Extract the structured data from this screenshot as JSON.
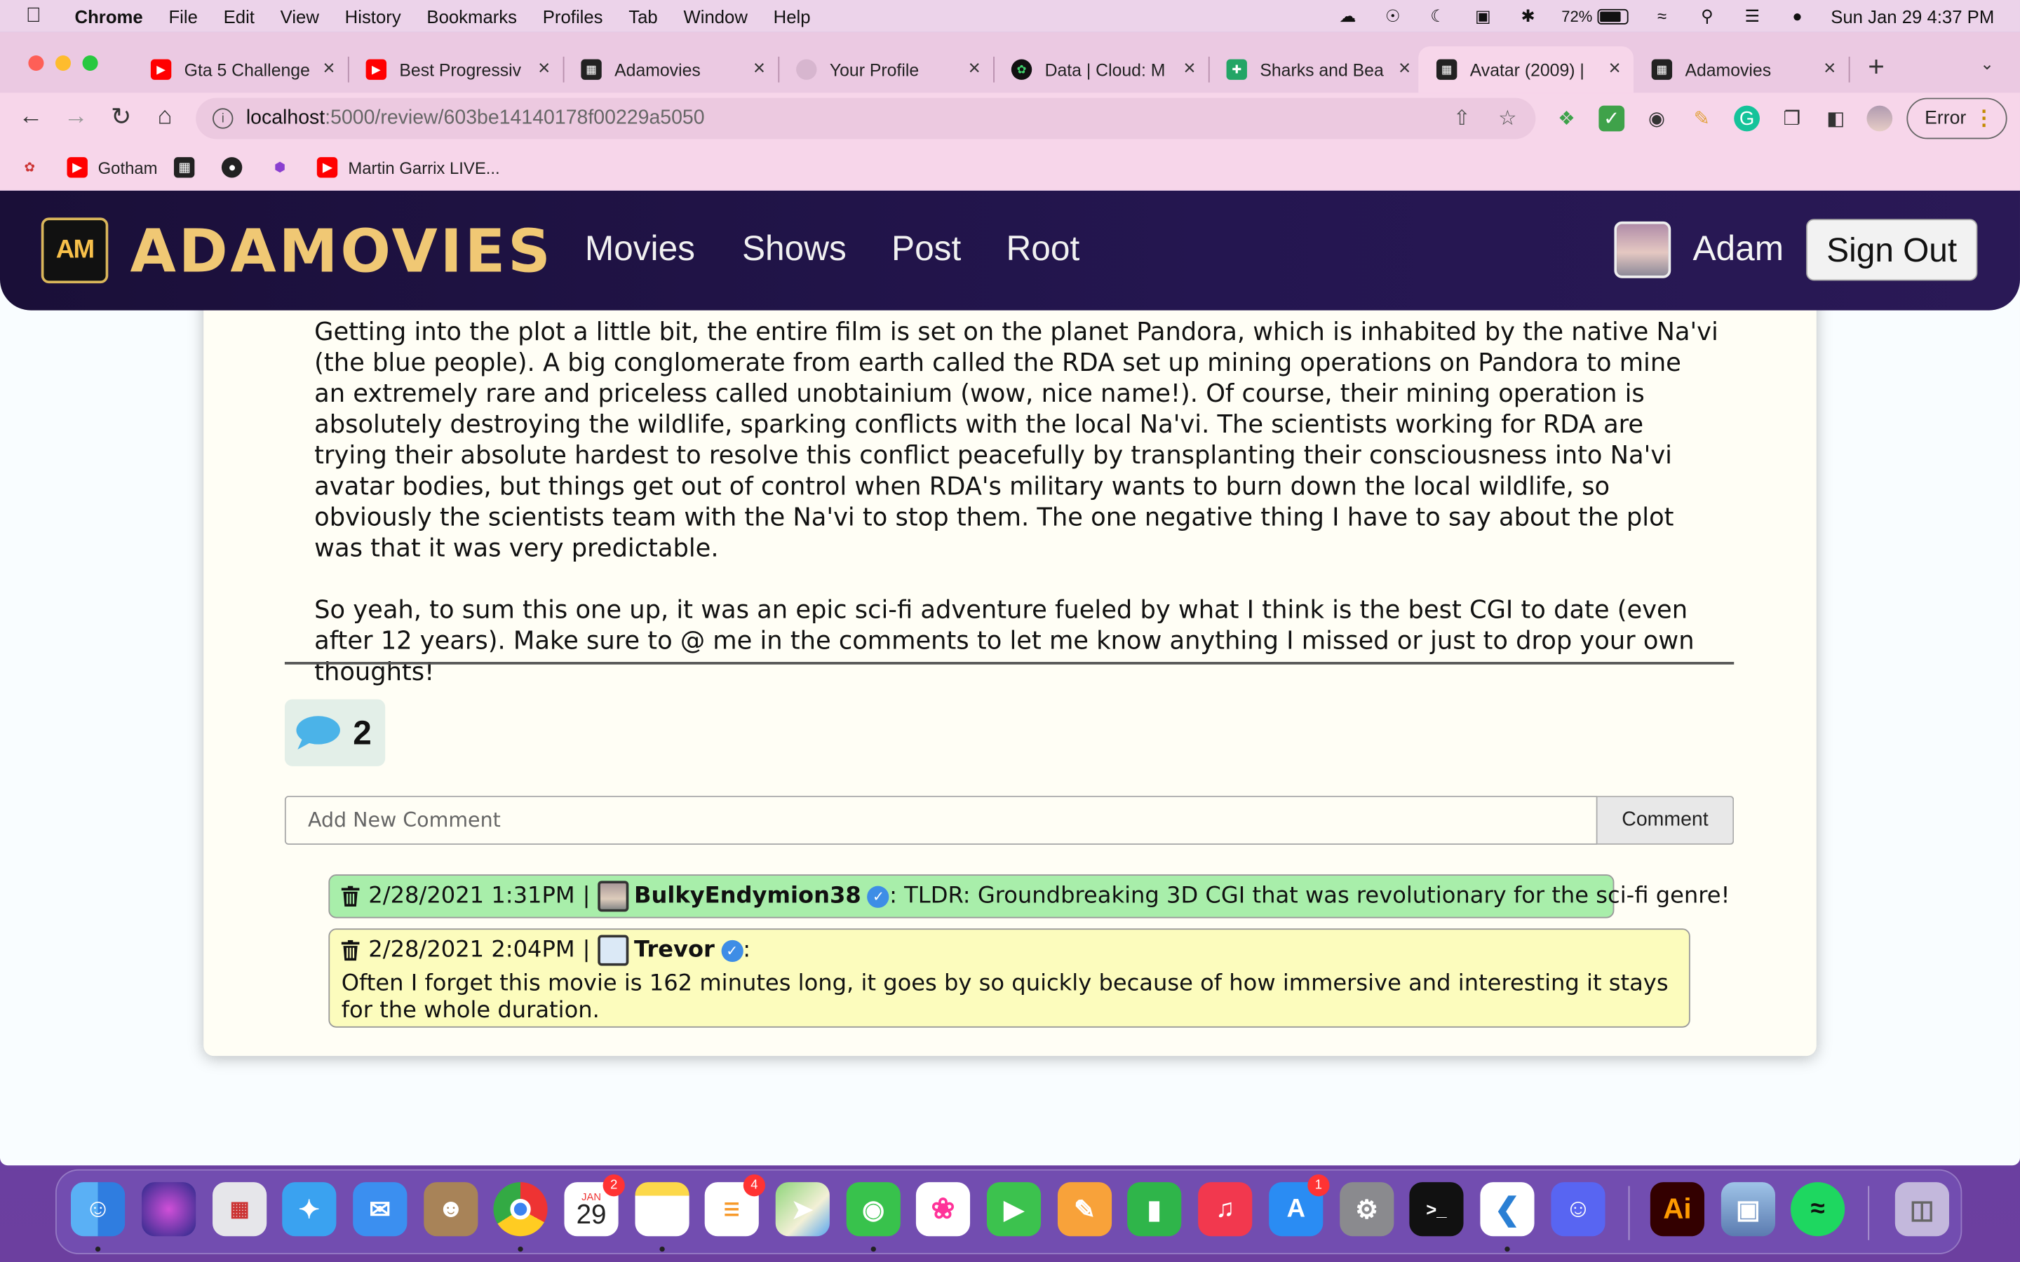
{
  "menubar": {
    "app_name": "Chrome",
    "items": [
      "File",
      "Edit",
      "View",
      "History",
      "Bookmarks",
      "Profiles",
      "Tab",
      "Window",
      "Help"
    ],
    "battery": "72%",
    "battery_level": 0.72,
    "datetime": "Sun Jan 29  4:37 PM"
  },
  "tabs": [
    {
      "title": "Gta 5 Challenge",
      "favicon": "youtube-icon",
      "active": false
    },
    {
      "title": "Best Progressiv",
      "favicon": "youtube-icon",
      "active": false
    },
    {
      "title": "Adamovies",
      "favicon": "film-icon",
      "active": false
    },
    {
      "title": "Your Profile",
      "favicon": "github-icon",
      "active": false
    },
    {
      "title": "Data | Cloud: M",
      "favicon": "mongodb-leaf-icon",
      "active": false
    },
    {
      "title": "Sharks and Bea",
      "favicon": "sheets-icon",
      "active": false
    },
    {
      "title": "Avatar (2009) |",
      "favicon": "film-icon",
      "active": true
    },
    {
      "title": "Adamovies",
      "favicon": "film-icon",
      "active": false
    }
  ],
  "omnibox": {
    "host": "localhost",
    "path": ":5000/review/603be14140178f00229a5050"
  },
  "profile_button": {
    "label": "Error"
  },
  "bookmarks": [
    {
      "label": "",
      "icon": "birds-icon"
    },
    {
      "label": "Gotham",
      "icon": "youtube-icon"
    },
    {
      "label": "",
      "icon": "film-icon"
    },
    {
      "label": "",
      "icon": "github-icon"
    },
    {
      "label": "",
      "icon": "cube-icon"
    },
    {
      "label": "Martin Garrix LIVE...",
      "icon": "youtube-icon"
    }
  ],
  "site": {
    "brand": "ADAMOVIES",
    "logo_text": "AM",
    "nav": [
      "Movies",
      "Shows",
      "Post",
      "Root"
    ],
    "user": "Adam",
    "signout_label": "Sign Out",
    "colors": {
      "nav_bg": "#1a0f38",
      "brand": "#f0c874"
    }
  },
  "review": {
    "paragraphs": [
      "Getting into the plot a little bit, the entire film is set on the planet Pandora, which is inhabited by the native Na'vi (the blue people). A big conglomerate from earth called the RDA set up mining operations on Pandora to mine an extremely rare and priceless called unobtainium (wow, nice name!). Of course, their mining operation is absolutely destroying the wildlife, sparking conflicts with the local Na'vi. The scientists working for RDA are trying their absolute hardest to resolve this conflict peacefully by transplanting their consciousness into Na'vi avatar bodies, but things get out of control when RDA's military wants to burn down the local wildlife, so obviously the scientists team with the Na'vi to stop them. The one negative thing I have to say about the plot was that it was very predictable.",
      "So yeah, to sum this one up, it was an epic sci-fi adventure fueled by what I think is the best CGI to date (even after 12 years). Make sure to @ me in the comments to let me know anything I missed or just to drop your own thoughts!"
    ]
  },
  "comments_section": {
    "count": "2",
    "input_placeholder": "Add New Comment",
    "button_label": "Comment",
    "comments": [
      {
        "timestamp": "2/28/2021 1:31PM",
        "separator": "|",
        "author": "BulkyEndymion38",
        "text": ": TLDR: Groundbreaking 3D CGI that was revolutionary for the sci-fi genre!",
        "color": "#a8eeaa"
      },
      {
        "timestamp": "2/28/2021 2:04PM",
        "separator": "|",
        "author": "Trevor",
        "suffix": ":",
        "text": "Often I forget this movie is 162 minutes long, it goes by so quickly because of how immersive and interesting it stays for the whole duration.",
        "color": "#fcfcbd"
      }
    ]
  },
  "dock": {
    "badges": {
      "calendar": "2",
      "reminders": "4",
      "appstore": "1"
    },
    "calendar_month": "JAN",
    "calendar_day": "29"
  }
}
